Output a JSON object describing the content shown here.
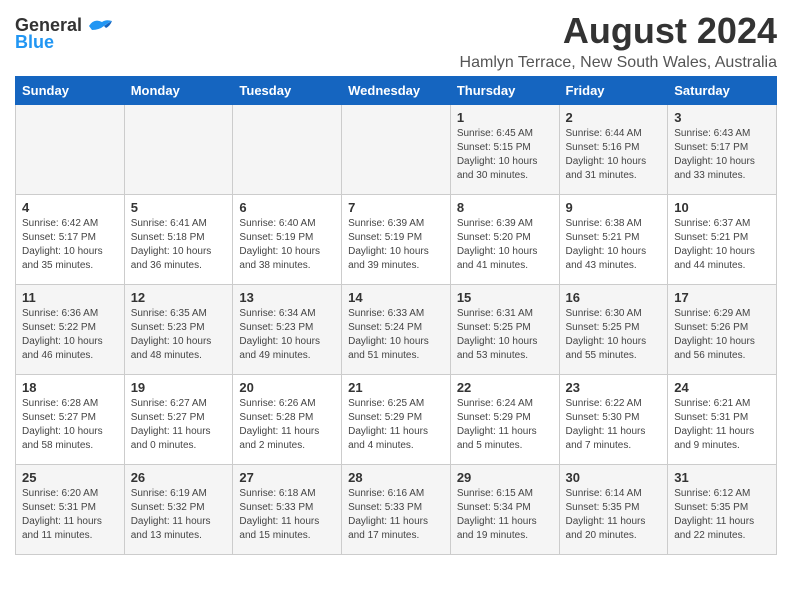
{
  "header": {
    "logo_line1": "General",
    "logo_line2": "Blue",
    "title": "August 2024",
    "subtitle": "Hamlyn Terrace, New South Wales, Australia"
  },
  "calendar": {
    "days_of_week": [
      "Sunday",
      "Monday",
      "Tuesday",
      "Wednesday",
      "Thursday",
      "Friday",
      "Saturday"
    ],
    "weeks": [
      [
        {
          "day": "",
          "text": ""
        },
        {
          "day": "",
          "text": ""
        },
        {
          "day": "",
          "text": ""
        },
        {
          "day": "",
          "text": ""
        },
        {
          "day": "1",
          "text": "Sunrise: 6:45 AM\nSunset: 5:15 PM\nDaylight: 10 hours\nand 30 minutes."
        },
        {
          "day": "2",
          "text": "Sunrise: 6:44 AM\nSunset: 5:16 PM\nDaylight: 10 hours\nand 31 minutes."
        },
        {
          "day": "3",
          "text": "Sunrise: 6:43 AM\nSunset: 5:17 PM\nDaylight: 10 hours\nand 33 minutes."
        }
      ],
      [
        {
          "day": "4",
          "text": "Sunrise: 6:42 AM\nSunset: 5:17 PM\nDaylight: 10 hours\nand 35 minutes."
        },
        {
          "day": "5",
          "text": "Sunrise: 6:41 AM\nSunset: 5:18 PM\nDaylight: 10 hours\nand 36 minutes."
        },
        {
          "day": "6",
          "text": "Sunrise: 6:40 AM\nSunset: 5:19 PM\nDaylight: 10 hours\nand 38 minutes."
        },
        {
          "day": "7",
          "text": "Sunrise: 6:39 AM\nSunset: 5:19 PM\nDaylight: 10 hours\nand 39 minutes."
        },
        {
          "day": "8",
          "text": "Sunrise: 6:39 AM\nSunset: 5:20 PM\nDaylight: 10 hours\nand 41 minutes."
        },
        {
          "day": "9",
          "text": "Sunrise: 6:38 AM\nSunset: 5:21 PM\nDaylight: 10 hours\nand 43 minutes."
        },
        {
          "day": "10",
          "text": "Sunrise: 6:37 AM\nSunset: 5:21 PM\nDaylight: 10 hours\nand 44 minutes."
        }
      ],
      [
        {
          "day": "11",
          "text": "Sunrise: 6:36 AM\nSunset: 5:22 PM\nDaylight: 10 hours\nand 46 minutes."
        },
        {
          "day": "12",
          "text": "Sunrise: 6:35 AM\nSunset: 5:23 PM\nDaylight: 10 hours\nand 48 minutes."
        },
        {
          "day": "13",
          "text": "Sunrise: 6:34 AM\nSunset: 5:23 PM\nDaylight: 10 hours\nand 49 minutes."
        },
        {
          "day": "14",
          "text": "Sunrise: 6:33 AM\nSunset: 5:24 PM\nDaylight: 10 hours\nand 51 minutes."
        },
        {
          "day": "15",
          "text": "Sunrise: 6:31 AM\nSunset: 5:25 PM\nDaylight: 10 hours\nand 53 minutes."
        },
        {
          "day": "16",
          "text": "Sunrise: 6:30 AM\nSunset: 5:25 PM\nDaylight: 10 hours\nand 55 minutes."
        },
        {
          "day": "17",
          "text": "Sunrise: 6:29 AM\nSunset: 5:26 PM\nDaylight: 10 hours\nand 56 minutes."
        }
      ],
      [
        {
          "day": "18",
          "text": "Sunrise: 6:28 AM\nSunset: 5:27 PM\nDaylight: 10 hours\nand 58 minutes."
        },
        {
          "day": "19",
          "text": "Sunrise: 6:27 AM\nSunset: 5:27 PM\nDaylight: 11 hours\nand 0 minutes."
        },
        {
          "day": "20",
          "text": "Sunrise: 6:26 AM\nSunset: 5:28 PM\nDaylight: 11 hours\nand 2 minutes."
        },
        {
          "day": "21",
          "text": "Sunrise: 6:25 AM\nSunset: 5:29 PM\nDaylight: 11 hours\nand 4 minutes."
        },
        {
          "day": "22",
          "text": "Sunrise: 6:24 AM\nSunset: 5:29 PM\nDaylight: 11 hours\nand 5 minutes."
        },
        {
          "day": "23",
          "text": "Sunrise: 6:22 AM\nSunset: 5:30 PM\nDaylight: 11 hours\nand 7 minutes."
        },
        {
          "day": "24",
          "text": "Sunrise: 6:21 AM\nSunset: 5:31 PM\nDaylight: 11 hours\nand 9 minutes."
        }
      ],
      [
        {
          "day": "25",
          "text": "Sunrise: 6:20 AM\nSunset: 5:31 PM\nDaylight: 11 hours\nand 11 minutes."
        },
        {
          "day": "26",
          "text": "Sunrise: 6:19 AM\nSunset: 5:32 PM\nDaylight: 11 hours\nand 13 minutes."
        },
        {
          "day": "27",
          "text": "Sunrise: 6:18 AM\nSunset: 5:33 PM\nDaylight: 11 hours\nand 15 minutes."
        },
        {
          "day": "28",
          "text": "Sunrise: 6:16 AM\nSunset: 5:33 PM\nDaylight: 11 hours\nand 17 minutes."
        },
        {
          "day": "29",
          "text": "Sunrise: 6:15 AM\nSunset: 5:34 PM\nDaylight: 11 hours\nand 19 minutes."
        },
        {
          "day": "30",
          "text": "Sunrise: 6:14 AM\nSunset: 5:35 PM\nDaylight: 11 hours\nand 20 minutes."
        },
        {
          "day": "31",
          "text": "Sunrise: 6:12 AM\nSunset: 5:35 PM\nDaylight: 11 hours\nand 22 minutes."
        }
      ]
    ]
  }
}
